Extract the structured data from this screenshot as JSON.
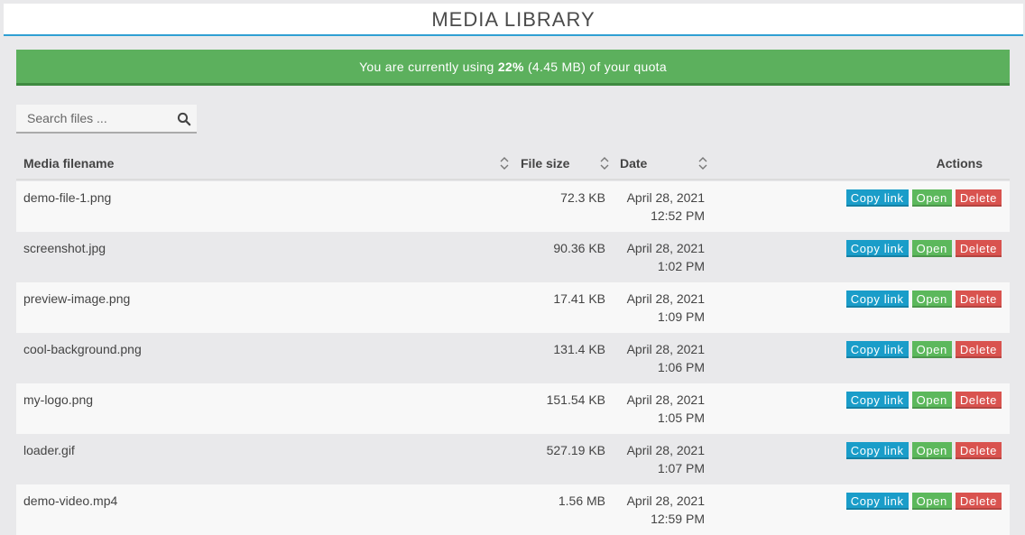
{
  "header": {
    "title": "MEDIA LIBRARY"
  },
  "quota": {
    "prefix": "You are currently using ",
    "percent": "22%",
    "suffix": " (4.45 MB) of your quota",
    "used_fraction": 0.22
  },
  "search": {
    "placeholder": "Search files ...",
    "value": ""
  },
  "table": {
    "headers": {
      "filename": "Media filename",
      "size": "File size",
      "date": "Date",
      "actions": "Actions"
    },
    "action_labels": {
      "copy": "Copy link",
      "open": "Open",
      "delete": "Delete"
    },
    "rows": [
      {
        "filename": "demo-file-1.png",
        "size": "72.3 KB",
        "date": "April 28, 2021",
        "time": "12:52 PM"
      },
      {
        "filename": "screenshot.jpg",
        "size": "90.36 KB",
        "date": "April 28, 2021",
        "time": "1:02 PM"
      },
      {
        "filename": "preview-image.png",
        "size": "17.41 KB",
        "date": "April 28, 2021",
        "time": "1:09 PM"
      },
      {
        "filename": "cool-background.png",
        "size": "131.4 KB",
        "date": "April 28, 2021",
        "time": "1:06 PM"
      },
      {
        "filename": "my-logo.png",
        "size": "151.54 KB",
        "date": "April 28, 2021",
        "time": "1:05 PM"
      },
      {
        "filename": "loader.gif",
        "size": "527.19 KB",
        "date": "April 28, 2021",
        "time": "1:07 PM"
      },
      {
        "filename": "demo-video.mp4",
        "size": "1.56 MB",
        "date": "April 28, 2021",
        "time": "12:59 PM"
      }
    ]
  },
  "colors": {
    "accent": "#2f9fd3",
    "quota_bar": "#5cb05d",
    "copy_button": "#1a9dc9",
    "open_button": "#5cb85c",
    "delete_button": "#d9534f"
  },
  "icons": {
    "search": "search-icon",
    "sort": "sort-icon"
  }
}
